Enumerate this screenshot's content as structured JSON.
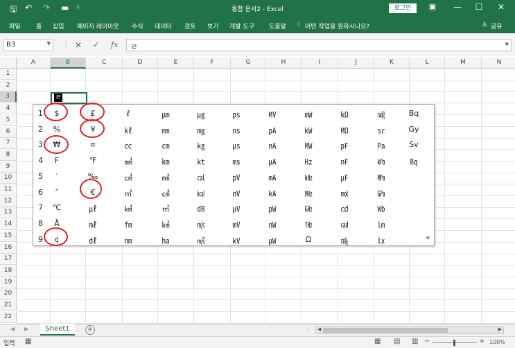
{
  "app": {
    "title": "통합 문서2  -  Excel",
    "login_label": "로그인",
    "window_buttons": [
      "ribbon-display-icon",
      "minimize-icon",
      "restore-icon",
      "close-icon"
    ]
  },
  "ribbon": {
    "tabs": [
      "파일",
      "홈",
      "삽입",
      "페이지 레이아웃",
      "수식",
      "데이터",
      "검토",
      "보기",
      "개발 도구",
      "도움말"
    ],
    "tell_me": "어떤 작업을 원하시나요?",
    "share": "공유"
  },
  "formula_bar": {
    "name_box": "B3",
    "formula": "ㄹ"
  },
  "grid": {
    "columns": [
      "A",
      "B",
      "C",
      "D",
      "E",
      "F",
      "G",
      "H",
      "I",
      "J",
      "K",
      "L",
      "M",
      "N"
    ],
    "rows": [
      "1",
      "2",
      "3",
      "4",
      "5",
      "6",
      "7",
      "8",
      "9",
      "10",
      "11",
      "12",
      "13",
      "14",
      "15",
      "16",
      "17",
      "18",
      "19",
      "20",
      "21",
      "22"
    ],
    "selected_column": "B",
    "selected_row": "3",
    "active_cell_value": "ㄹ"
  },
  "symbol_popup": {
    "numbers": [
      "1",
      "2",
      "3",
      "4",
      "5",
      "6",
      "7",
      "8",
      "9"
    ],
    "columns": [
      [
        "$",
        "%",
        "₩",
        "F",
        "′",
        "″",
        "℃",
        "Å",
        "¢"
      ],
      [
        "£",
        "¥",
        "¤",
        "℉",
        "‰",
        "€",
        "㎕",
        "㎖",
        "㎗"
      ],
      [
        "ℓ",
        "㎘",
        "㏄",
        "㎣",
        "㎤",
        "㎥",
        "㎦",
        "㎙",
        "㎚"
      ],
      [
        "㎛",
        "㎜",
        "㎝",
        "㎞",
        "㎟",
        "㎠",
        "㎡",
        "㎢",
        "㏊"
      ],
      [
        "㎍",
        "㎎",
        "㎏",
        "㏏",
        "㎈",
        "㎉",
        "㏈",
        "㎧",
        "㎨"
      ],
      [
        "㎰",
        "㎱",
        "㎲",
        "㎳",
        "㎴",
        "㎵",
        "㎶",
        "㎷",
        "㎸"
      ],
      [
        "㎹",
        "㎀",
        "㎁",
        "㎂",
        "㎃",
        "㎄",
        "㎺",
        "㎻",
        "㎼"
      ],
      [
        "㎽",
        "㎾",
        "㎿",
        "㎐",
        "㎑",
        "㎒",
        "㎓",
        "㎔",
        "Ω"
      ],
      [
        "㏀",
        "㏁",
        "㎊",
        "㎋",
        "㎌",
        "㏖",
        "㏅",
        "㎭",
        "㎮"
      ],
      [
        "㎯",
        "㏛",
        "㎩",
        "㎪",
        "㎫",
        "㎬",
        "㏝",
        "㏐",
        "㏓"
      ],
      [
        "Bq",
        "Gy",
        "Sv",
        "㏃",
        "",
        "",
        "",
        "",
        ""
      ]
    ],
    "more_label": "«"
  },
  "sheets": {
    "tabs": [
      "Sheet1"
    ],
    "add_label": "+"
  },
  "status": {
    "mode": "입력",
    "zoom": "100%"
  }
}
